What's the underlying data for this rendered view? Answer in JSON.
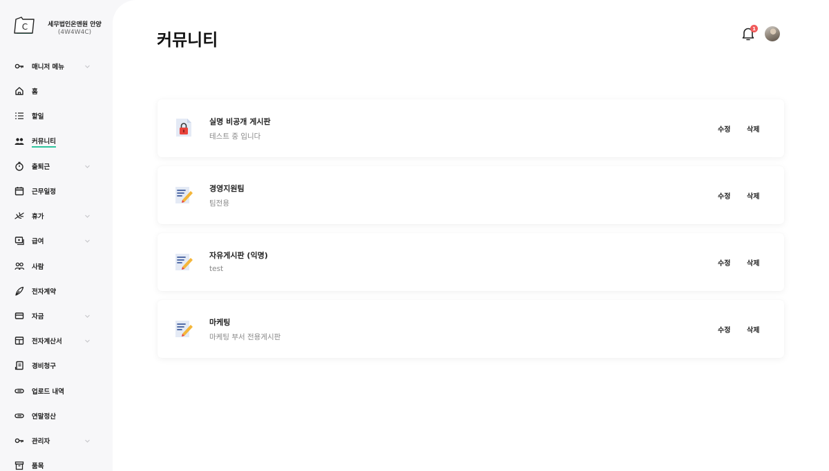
{
  "brand": {
    "name": "세무법인온앤원 안양",
    "code": "(4W4W4C)",
    "logo_letter": "C"
  },
  "sidebar": {
    "items": [
      {
        "label": "매니저 메뉴",
        "icon": "key-icon",
        "chevron": true
      },
      {
        "label": "홈",
        "icon": "home-icon",
        "chevron": false
      },
      {
        "label": "할일",
        "icon": "list-icon",
        "chevron": false
      },
      {
        "label": "커뮤니티",
        "icon": "people-icon",
        "chevron": false,
        "active": true
      },
      {
        "label": "출퇴근",
        "icon": "stopwatch-icon",
        "chevron": true
      },
      {
        "label": "근무일정",
        "icon": "calendar-icon",
        "chevron": false
      },
      {
        "label": "휴가",
        "icon": "plane-icon",
        "chevron": true
      },
      {
        "label": "급여",
        "icon": "money-icon",
        "chevron": true
      },
      {
        "label": "사람",
        "icon": "users-icon",
        "chevron": false
      },
      {
        "label": "전자계약",
        "icon": "pen-icon",
        "chevron": false
      },
      {
        "label": "자금",
        "icon": "card-icon",
        "chevron": true
      },
      {
        "label": "전자계산서",
        "icon": "table-icon",
        "chevron": true
      },
      {
        "label": "경비청구",
        "icon": "receipt-icon",
        "chevron": false
      },
      {
        "label": "업로드 내역",
        "icon": "paperclip-icon",
        "chevron": false
      },
      {
        "label": "연말정산",
        "icon": "paperclip-icon",
        "chevron": false
      },
      {
        "label": "관리자",
        "icon": "key-icon",
        "chevron": true
      },
      {
        "label": "품목",
        "icon": "box-icon",
        "chevron": false
      }
    ]
  },
  "header": {
    "title": "커뮤니티",
    "notification_count": "1"
  },
  "boards": [
    {
      "title": "실명 비공개 게시판",
      "description": "테스트 중 입니다",
      "icon": "locked-document-icon",
      "edit_label": "수정",
      "delete_label": "삭제"
    },
    {
      "title": "경영지원팀",
      "description": "팀전용",
      "icon": "memo-icon",
      "edit_label": "수정",
      "delete_label": "삭제"
    },
    {
      "title": "자유게시판 (익명)",
      "description": "test",
      "icon": "memo-icon",
      "edit_label": "수정",
      "delete_label": "삭제"
    },
    {
      "title": "마케팅",
      "description": "마케팅 부서 전용게시판",
      "icon": "memo-icon",
      "edit_label": "수정",
      "delete_label": "삭제"
    }
  ],
  "colors": {
    "accent": "#2bc39b",
    "badge": "#f05a5a",
    "sidebar_bg": "#f7f7f9"
  }
}
